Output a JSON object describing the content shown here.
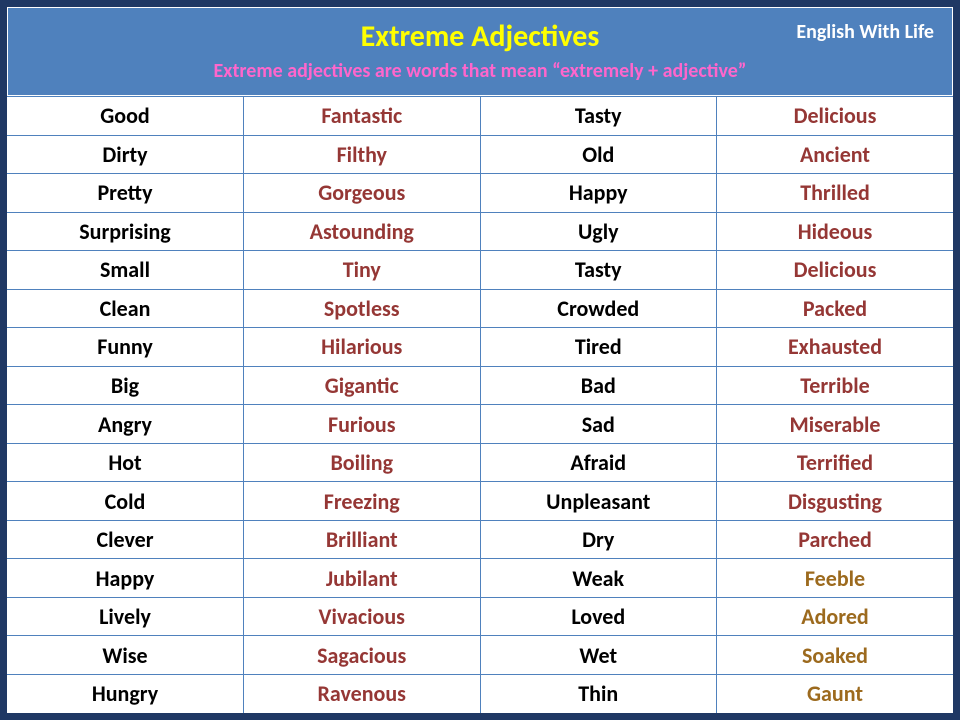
{
  "header": {
    "title": "Extreme Adjectives",
    "brand": "English With Life",
    "subtitle": "Extreme adjectives  are words that mean “extremely + adjective”"
  },
  "rows": [
    {
      "a1": "Good",
      "e1": "Fantastic",
      "a2": "Tasty",
      "e2": "Delicious",
      "alt": false
    },
    {
      "a1": "Dirty",
      "e1": "Filthy",
      "a2": "Old",
      "e2": "Ancient",
      "alt": false
    },
    {
      "a1": "Pretty",
      "e1": "Gorgeous",
      "a2": "Happy",
      "e2": "Thrilled",
      "alt": false
    },
    {
      "a1": "Surprising",
      "e1": "Astounding",
      "a2": "Ugly",
      "e2": "Hideous",
      "alt": false
    },
    {
      "a1": "Small",
      "e1": "Tiny",
      "a2": "Tasty",
      "e2": "Delicious",
      "alt": false
    },
    {
      "a1": "Clean",
      "e1": "Spotless",
      "a2": "Crowded",
      "e2": "Packed",
      "alt": false
    },
    {
      "a1": "Funny",
      "e1": "Hilarious",
      "a2": "Tired",
      "e2": "Exhausted",
      "alt": false
    },
    {
      "a1": "Big",
      "e1": "Gigantic",
      "a2": "Bad",
      "e2": "Terrible",
      "alt": false
    },
    {
      "a1": "Angry",
      "e1": "Furious",
      "a2": "Sad",
      "e2": "Miserable",
      "alt": false
    },
    {
      "a1": "Hot",
      "e1": "Boiling",
      "a2": "Afraid",
      "e2": "Terrified",
      "alt": false
    },
    {
      "a1": "Cold",
      "e1": "Freezing",
      "a2": "Unpleasant",
      "e2": "Disgusting",
      "alt": false
    },
    {
      "a1": "Clever",
      "e1": "Brilliant",
      "a2": "Dry",
      "e2": "Parched",
      "alt": false
    },
    {
      "a1": "Happy",
      "e1": "Jubilant",
      "a2": "Weak",
      "e2": "Feeble",
      "alt": true
    },
    {
      "a1": "Lively",
      "e1": "Vivacious",
      "a2": "Loved",
      "e2": "Adored",
      "alt": true
    },
    {
      "a1": "Wise",
      "e1": "Sagacious",
      "a2": "Wet",
      "e2": "Soaked",
      "alt": true
    },
    {
      "a1": "Hungry",
      "e1": "Ravenous",
      "a2": "Thin",
      "e2": "Gaunt",
      "alt": true
    }
  ]
}
